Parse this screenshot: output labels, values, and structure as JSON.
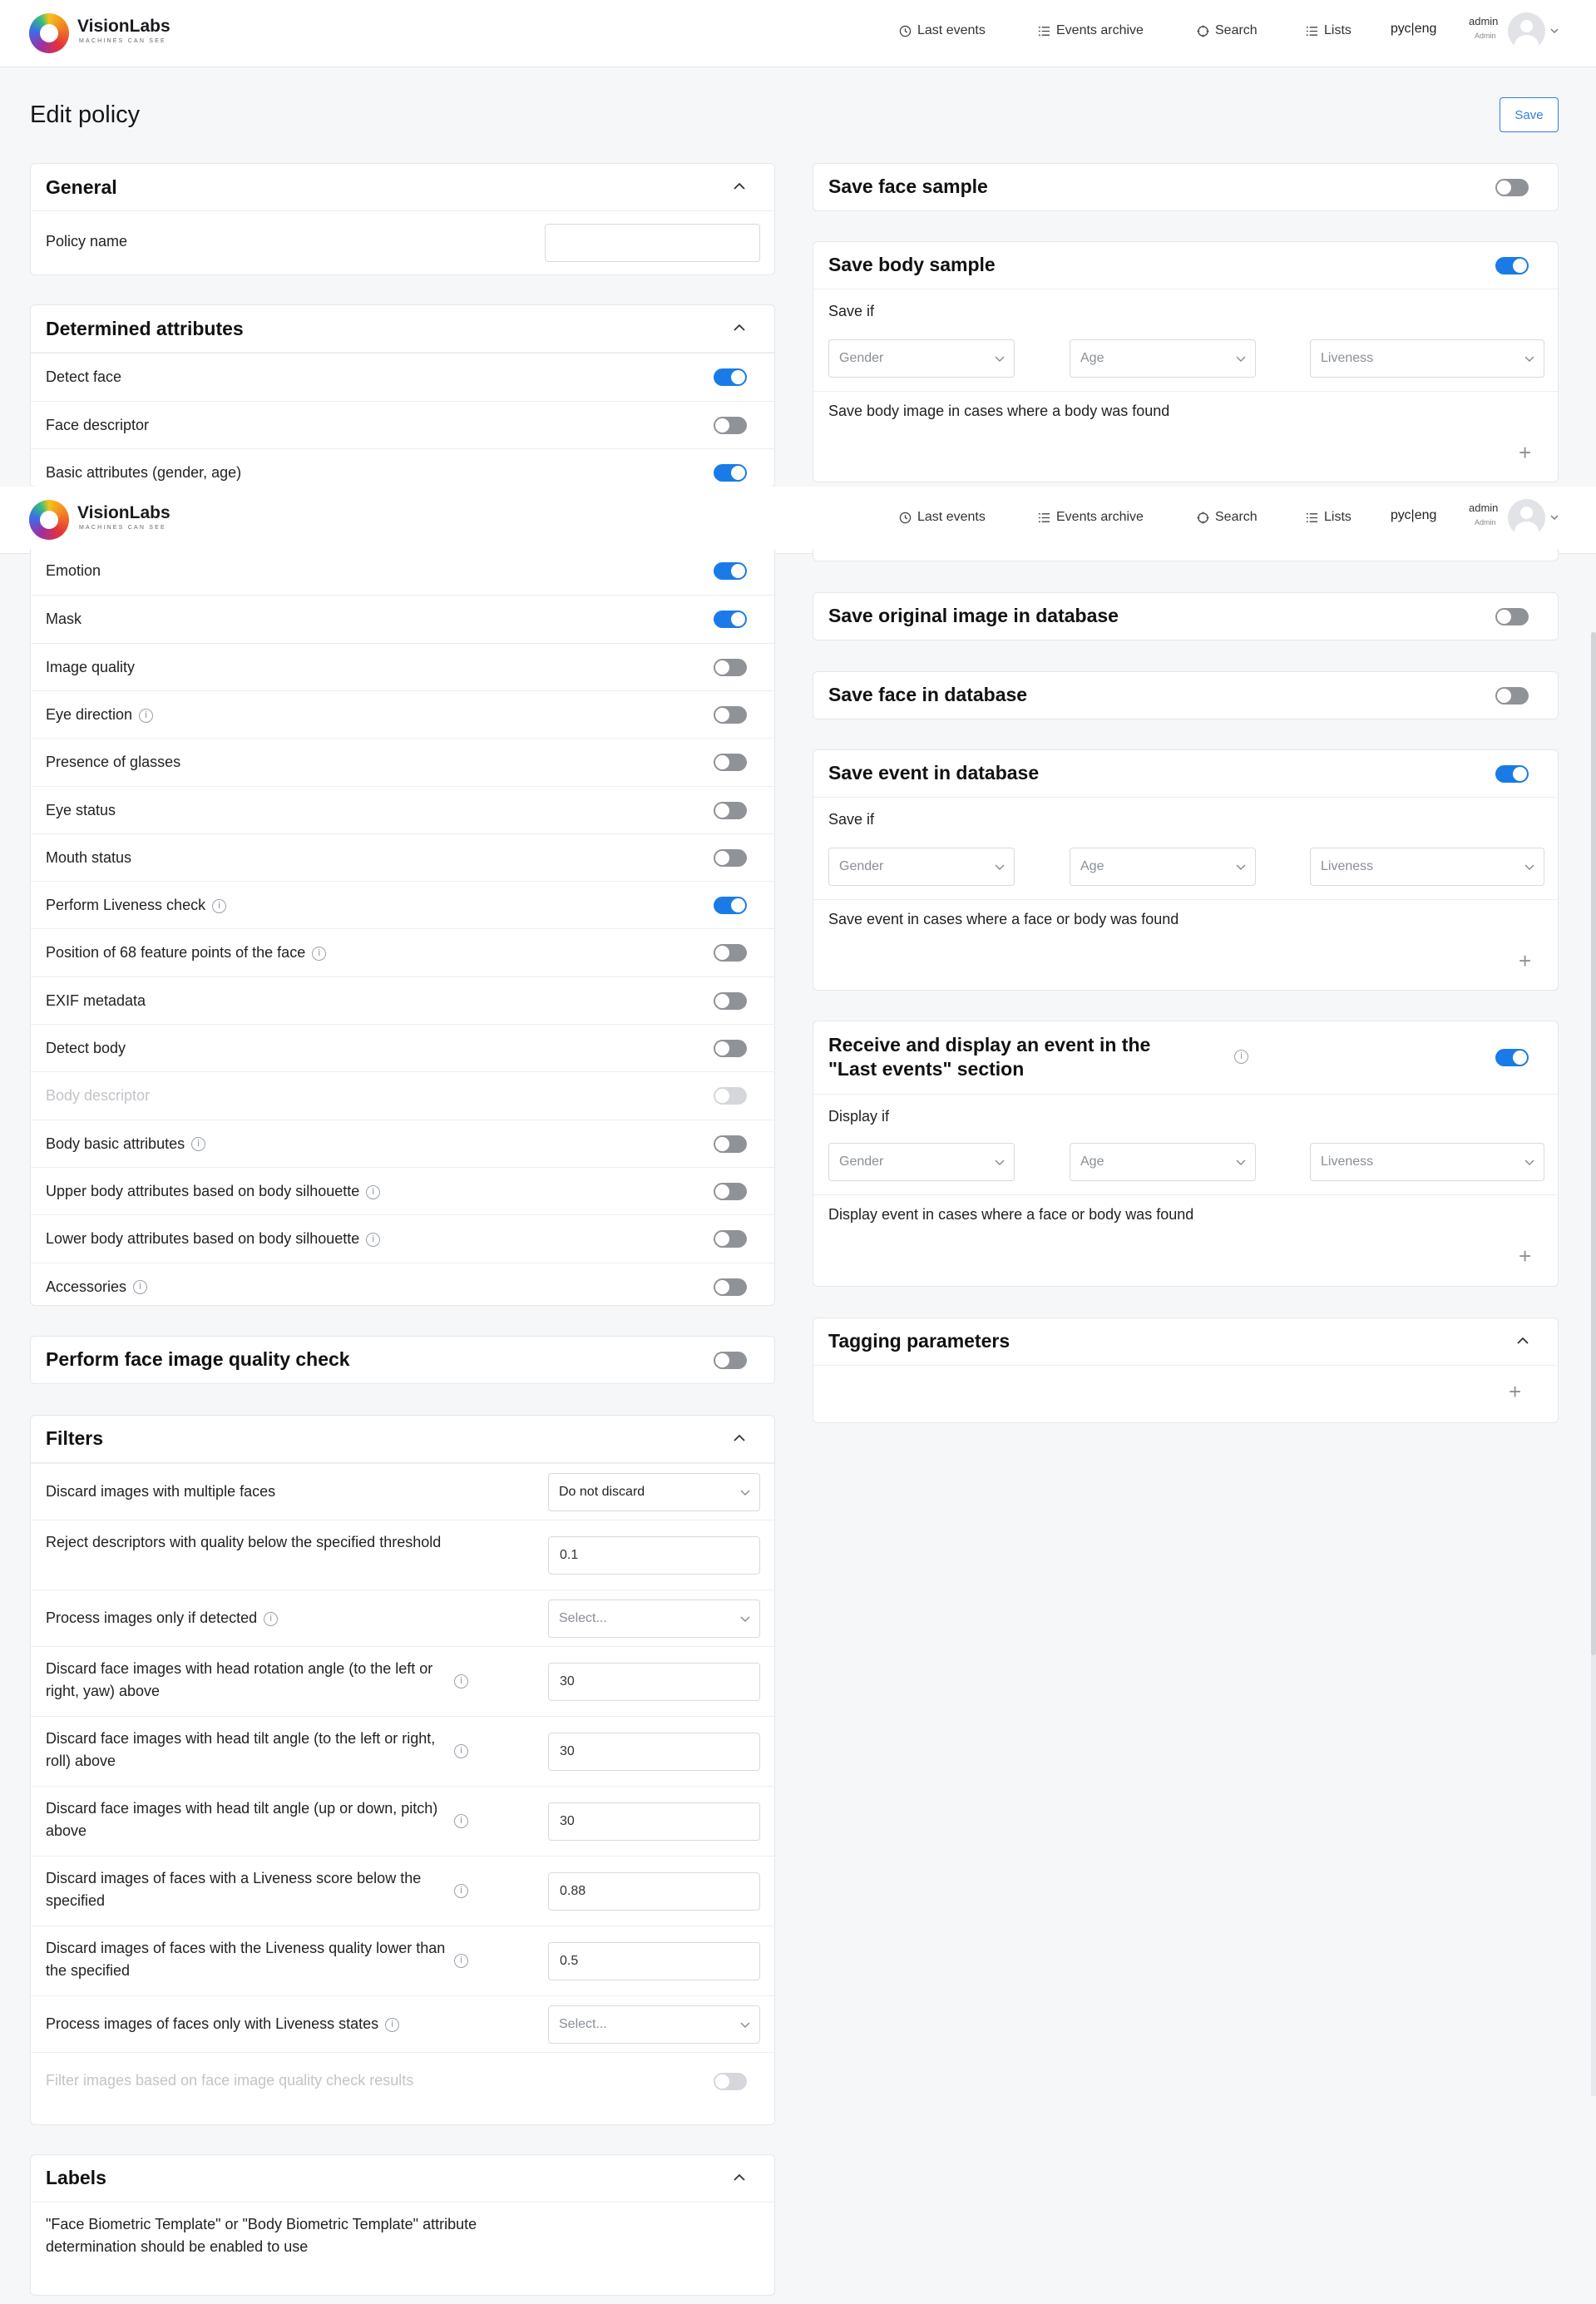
{
  "header": {
    "brand": "VisionLabs",
    "tagline": "MACHINES CAN SEE",
    "nav": [
      "Last events",
      "Events archive",
      "Search",
      "Lists"
    ],
    "lang": "рус|eng",
    "user_name": "admin",
    "user_role": "Admin"
  },
  "page": {
    "title": "Edit policy",
    "save_label": "Save"
  },
  "general": {
    "title": "General",
    "policy_name_label": "Policy name",
    "policy_name_value": ""
  },
  "determined_attributes": {
    "title": "Determined attributes",
    "items_top": [
      {
        "label": "Detect face",
        "on": true
      },
      {
        "label": "Face descriptor",
        "on": false
      },
      {
        "label": "Basic attributes (gender, age)",
        "on": true
      }
    ],
    "items": [
      {
        "label": "Emotion",
        "on": true
      },
      {
        "label": "Mask",
        "on": true
      },
      {
        "label": "Image quality",
        "on": false
      },
      {
        "label": "Eye direction",
        "on": false,
        "info": true
      },
      {
        "label": "Presence of glasses",
        "on": false
      },
      {
        "label": "Eye status",
        "on": false
      },
      {
        "label": "Mouth status",
        "on": false
      },
      {
        "label": "Perform Liveness check",
        "on": true,
        "info": true
      },
      {
        "label": "Position of 68 feature points of the face",
        "on": false,
        "info": true
      },
      {
        "label": "EXIF metadata",
        "on": false
      },
      {
        "label": "Detect body",
        "on": false
      },
      {
        "label": "Body descriptor",
        "on": false,
        "disabled": true
      },
      {
        "label": "Body basic attributes",
        "on": false,
        "info": true
      },
      {
        "label": "Upper body attributes based on body silhouette",
        "on": false,
        "info": true
      },
      {
        "label": "Lower body attributes based on body silhouette",
        "on": false,
        "info": true
      },
      {
        "label": "Accessories",
        "on": false,
        "info": true
      }
    ]
  },
  "face_quality_check": {
    "title": "Perform face image quality check",
    "on": false
  },
  "filters": {
    "title": "Filters",
    "rows": [
      {
        "label": "Discard images with multiple faces",
        "type": "select",
        "value": "Do not discard"
      },
      {
        "label": "Reject descriptors with quality below the specified threshold",
        "type": "input",
        "value": "0.1"
      },
      {
        "label": "Process images only if detected",
        "type": "select",
        "value": "Select...",
        "info": true
      },
      {
        "label": "Discard face images with head rotation angle (to the left or right, yaw) above",
        "type": "input",
        "value": "30",
        "info": true
      },
      {
        "label": "Discard face images with head tilt angle (to the left or right, roll) above",
        "type": "input",
        "value": "30",
        "info": true
      },
      {
        "label": "Discard face images with head tilt angle (up or down, pitch) above",
        "type": "input",
        "value": "30",
        "info": true
      },
      {
        "label": "Discard images of faces with a Liveness score below the specified",
        "type": "input",
        "value": "0.88",
        "info": true
      },
      {
        "label": "Discard images of faces with the Liveness quality lower than the specified",
        "type": "input",
        "value": "0.5",
        "info": true
      },
      {
        "label": "Process images of faces only with Liveness states",
        "type": "select",
        "value": "Select...",
        "info": true
      },
      {
        "label": "Filter images based on face image quality check results",
        "type": "toggle",
        "disabled": true
      }
    ]
  },
  "labels": {
    "title": "Labels",
    "note": "\"Face Biometric Template\" or \"Body Biometric Template\" attribute determination should be enabled to use"
  },
  "right": {
    "save_face_sample": {
      "title": "Save face sample",
      "on": false
    },
    "save_body_sample": {
      "title": "Save body sample",
      "on": true,
      "condition_label": "Save if",
      "desc": "Save body image in cases where a body was found"
    },
    "save_original_image": {
      "title": "Save original image in database",
      "on": false
    },
    "save_face_db": {
      "title": "Save face in database",
      "on": false
    },
    "save_event_db": {
      "title": "Save event in database",
      "on": true,
      "condition_label": "Save if",
      "desc": "Save event in cases where a face or body was found"
    },
    "receive_display": {
      "title_line1": "Receive and display an event in the",
      "title_line2": "\"Last events\" section",
      "on": true,
      "condition_label": "Display if",
      "desc": "Display event in cases where a face or body was found"
    },
    "tagging": {
      "title": "Tagging parameters"
    }
  },
  "filter_selects": {
    "gender": "Gender",
    "age": "Age",
    "liveness": "Liveness"
  }
}
